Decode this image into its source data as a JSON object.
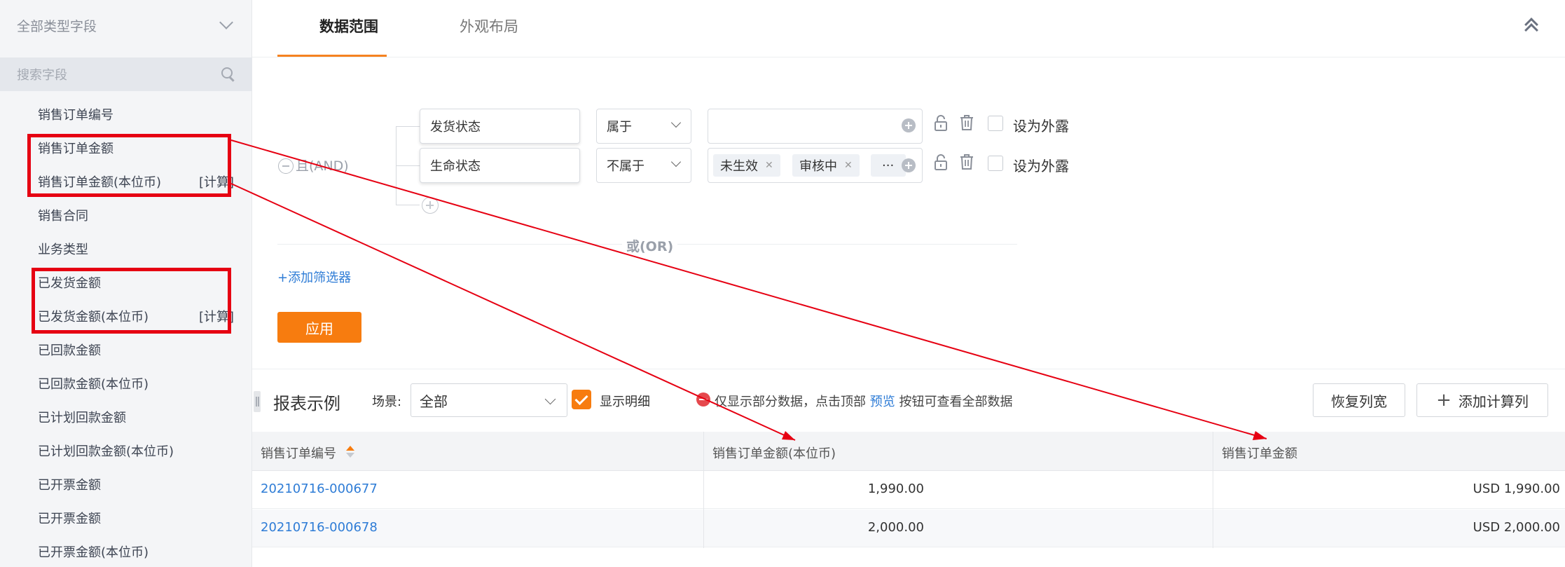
{
  "sidebar": {
    "type_select": "全部类型字段",
    "search_placeholder": "搜索字段",
    "fields": [
      {
        "label": "销售订单编号",
        "tag": ""
      },
      {
        "label": "销售订单金额",
        "tag": ""
      },
      {
        "label": "销售订单金额(本位币)",
        "tag": "[计算]"
      },
      {
        "label": "销售合同",
        "tag": ""
      },
      {
        "label": "业务类型",
        "tag": ""
      },
      {
        "label": "已发货金额",
        "tag": ""
      },
      {
        "label": "已发货金额(本位币)",
        "tag": "[计算]"
      },
      {
        "label": "已回款金额",
        "tag": ""
      },
      {
        "label": "已回款金额(本位币)",
        "tag": ""
      },
      {
        "label": "已计划回款金额",
        "tag": ""
      },
      {
        "label": "已计划回款金额(本位币)",
        "tag": ""
      },
      {
        "label": "已开票金额",
        "tag": ""
      },
      {
        "label": "已开票金额",
        "tag": ""
      },
      {
        "label": "已开票金额(本位币)",
        "tag": ""
      }
    ]
  },
  "tabs": [
    {
      "label": "数据范围",
      "active": true
    },
    {
      "label": "外观布局",
      "active": false
    }
  ],
  "filter": {
    "and_label": "且(AND)",
    "conditions": [
      {
        "field": "发货状态",
        "operator": "属于",
        "values": [],
        "expose_label": "设为外露"
      },
      {
        "field": "生命状态",
        "operator": "不属于",
        "values": [
          "未生效",
          "审核中",
          "···"
        ],
        "expose_label": "设为外露"
      }
    ],
    "or_label": "或(OR)",
    "add_filter": "+添加筛选器",
    "apply": "应用"
  },
  "report": {
    "title": "报表示例",
    "scene_label": "场景:",
    "scene_value": "全部",
    "show_detail": "显示明细",
    "note_prefix": "仅显示部分数据，点击顶部",
    "note_link": "预览",
    "note_suffix": "按钮可查看全部数据",
    "reset_width": "恢复列宽",
    "add_calc_col": "添加计算列",
    "columns": [
      "销售订单编号",
      "销售订单金额(本位币)",
      "销售订单金额"
    ],
    "rows": [
      {
        "order_no": "20210716-000677",
        "amount_base": "1,990.00",
        "amount": "USD 1,990.00"
      },
      {
        "order_no": "20210716-000678",
        "amount_base": "2,000.00",
        "amount": "USD 2,000.00"
      }
    ]
  },
  "colors": {
    "accent": "#f77c0f",
    "link": "#2e7cd6",
    "annotation": "#e60012"
  }
}
